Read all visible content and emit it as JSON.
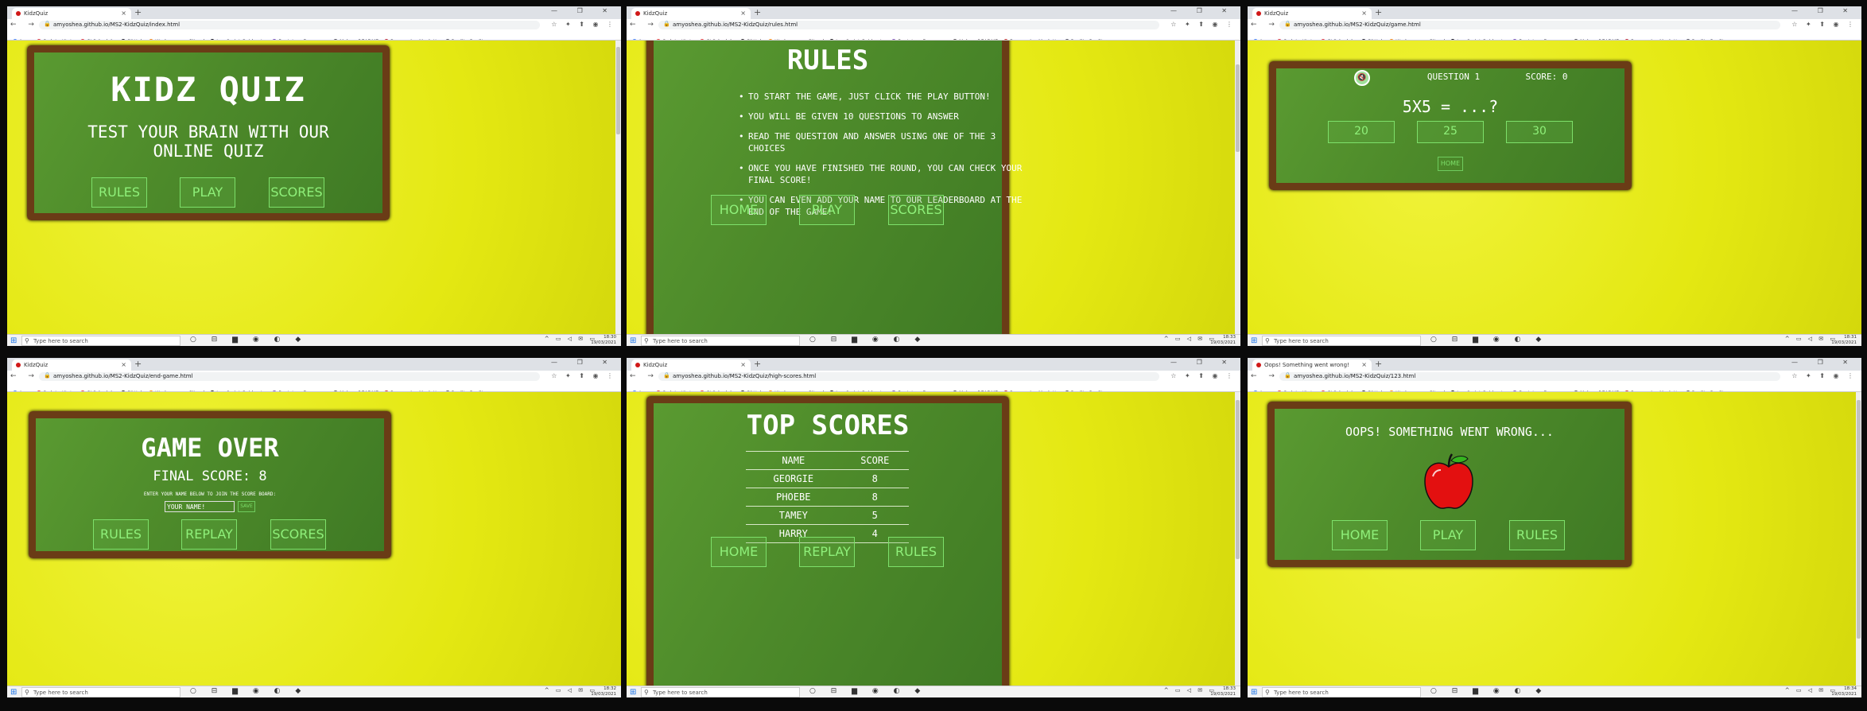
{
  "common": {
    "new_tab": "+",
    "nav": "← → C",
    "window_controls": "— ❐ ✕",
    "extensions": "☆ ✦ ⬆ ◉ ⋮",
    "tab_close": "×",
    "lock": "🔒",
    "bookmarks": [
      {
        "label": "Apps",
        "color": "#4285f4"
      },
      {
        "label": "CodeInstitute",
        "color": "#e53935"
      },
      {
        "label": "CI Schedule",
        "color": "#e53935"
      },
      {
        "label": "GitHub",
        "color": "#222222"
      },
      {
        "label": "Workspaces - Gitpod",
        "color": "#ff8a00"
      },
      {
        "label": "JavaScript Guide - J...",
        "color": "#111111"
      },
      {
        "label": "Bootstrap Docume...",
        "color": "#7952b3"
      },
      {
        "label": "Make a README",
        "color": "#555555"
      },
      {
        "label": "Responsive Mock Up",
        "color": "#c62828"
      },
      {
        "label": "Replit - Replit",
        "color": "#555555"
      }
    ],
    "taskbar": {
      "start": "⊞",
      "search_icon": "⚲",
      "search": "Type here to search",
      "icons": "○ ⊟ ▆ ◉ ◐ ◆",
      "tray": "^ ▭ ◁ ✉ ▭"
    },
    "button_labels": {
      "rules": "RULES",
      "play": "PLAY",
      "scores": "SCORES",
      "home": "HOME",
      "replay": "REPLAY"
    },
    "colors": {
      "board": "#4d8a2a",
      "frame": "#6a3c16",
      "background": "#e6ea1a",
      "button_text": "#8ff07a"
    }
  },
  "screens": [
    {
      "tab_title": "KidzQuiz",
      "url": "amyoshea.github.io/MS2-KidzQuiz/index.html",
      "time": "18:30",
      "date": "19/03/2021",
      "title": "KIDZ QUIZ",
      "subtitle_line1": "TEST YOUR BRAIN WITH OUR",
      "subtitle_line2": "ONLINE QUIZ"
    },
    {
      "tab_title": "KidzQuiz",
      "url": "amyoshea.github.io/MS2-KidzQuiz/rules.html",
      "time": "18:33",
      "date": "19/03/2021",
      "title": "RULES",
      "rules": [
        "To start the game, just click the play button!",
        "You will be given 10 questions to answer",
        "Read the question and answer using one of the 3 choices",
        "Once you have finished the round, you can check your final score!",
        "You can even add your name to our leaderboard at the end of the game!"
      ]
    },
    {
      "tab_title": "KidzQuiz",
      "url": "amyoshea.github.io/MS2-KidzQuiz/game.html",
      "time": "18:31",
      "date": "19/03/2021",
      "mute_icon": "🔇",
      "question_label": "QUESTION 1",
      "score_label": "SCORE: 0",
      "question": "5X5 = ...?",
      "answers": [
        "20",
        "25",
        "30"
      ],
      "home_label": "HOME"
    },
    {
      "tab_title": "KidzQuiz",
      "url": "amyoshea.github.io/MS2-KidzQuiz/end-game.html",
      "time": "18:32",
      "date": "19/03/2021",
      "title": "GAME OVER",
      "final_score": "FINAL SCORE: 8",
      "prompt": "ENTER YOUR NAME BELOW TO JOIN THE SCORE BOARD:",
      "name_value": "YOUR NAME!",
      "save_label": "SAVE"
    },
    {
      "tab_title": "KidzQuiz",
      "url": "amyoshea.github.io/MS2-KidzQuiz/high-scores.html",
      "time": "18:33",
      "date": "19/03/2021",
      "title": "TOP SCORES",
      "columns": [
        "NAME",
        "SCORE"
      ],
      "rows": [
        {
          "name": "GEORGIE",
          "score": "8"
        },
        {
          "name": "PHOEBE",
          "score": "8"
        },
        {
          "name": "TAMEY",
          "score": "5"
        },
        {
          "name": "HARRY",
          "score": "4"
        }
      ]
    },
    {
      "tab_title": "Oops! Something went wrong!",
      "url": "amyoshea.github.io/MS2-KidzQuiz/123.html",
      "time": "18:34",
      "date": "19/03/2021",
      "message": "OOPS! SOMETHING WENT WRONG..."
    }
  ]
}
